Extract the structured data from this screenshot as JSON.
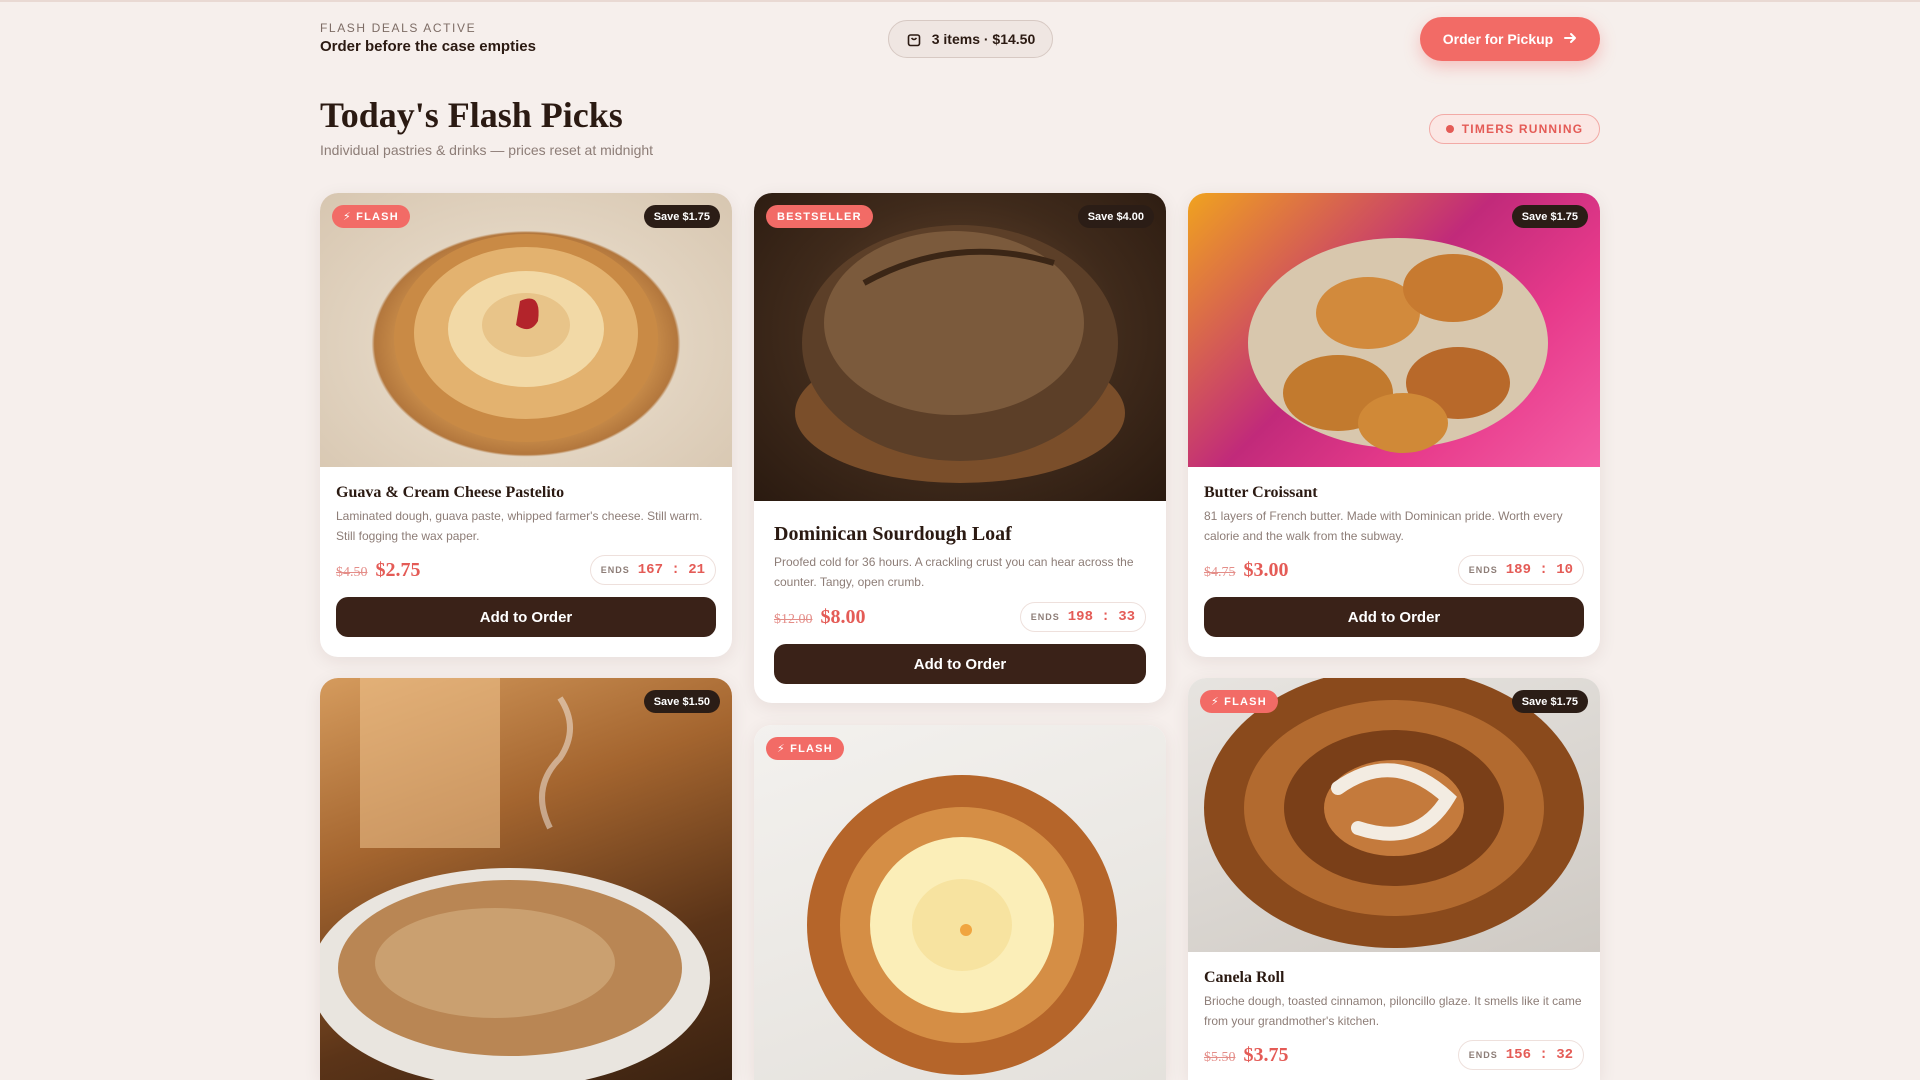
{
  "header": {
    "eyebrow": "FLASH DEALS ACTIVE",
    "subtitle": "Order before the case empties",
    "cart": "3 items · $14.50",
    "order_button": "Order for Pickup",
    "order_icon": "arrow-right-icon"
  },
  "main": {
    "title": "Today's Flash Picks",
    "subtitle": "Individual pastries & drinks — prices reset at midnight",
    "timers": "TIMERS RUNNING"
  },
  "colors": {
    "accent": "#f26b66",
    "dark": "#3a2218",
    "background": "#f6efec"
  },
  "products": [
    {
      "badge": "⚡ FLASH",
      "save": "Save $1.75",
      "title": "Guava & Cream Cheese Pastelito",
      "desc": "Laminated dough, guava paste, whipped farmer's cheese. Still warm. Still fogging the wax paper.",
      "old_price": "$4.50",
      "price": "$2.75",
      "ends_label": "ENDS",
      "ends_time": "167 : 21",
      "button": "Add to Order"
    },
    {
      "badge": "BESTSELLER",
      "save": "Save $4.00",
      "title": "Dominican Sourdough Loaf",
      "desc": "Proofed cold for 36 hours. A crackling crust you can hear across the counter. Tangy, open crumb.",
      "old_price": "$12.00",
      "price": "$8.00",
      "ends_label": "ENDS",
      "ends_time": "198 : 33",
      "button": "Add to Order"
    },
    {
      "badge": "",
      "save": "Save $1.75",
      "title": "Butter Croissant",
      "desc": "81 layers of French butter. Made with Dominican pride. Worth every calorie and the walk from the subway.",
      "old_price": "$4.75",
      "price": "$3.00",
      "ends_label": "ENDS",
      "ends_time": "189 : 10",
      "button": "Add to Order"
    },
    {
      "badge": "",
      "save": "Save $1.50",
      "title": "",
      "desc": "",
      "old_price": "",
      "price": "",
      "ends_label": "",
      "ends_time": "",
      "button": ""
    },
    {
      "badge": "⚡ FLASH",
      "save": "",
      "title": "",
      "desc": "",
      "old_price": "",
      "price": "",
      "ends_label": "",
      "ends_time": "",
      "button": ""
    },
    {
      "badge": "⚡ FLASH",
      "save": "Save $1.75",
      "title": "Canela Roll",
      "desc": "Brioche dough, toasted cinnamon, piloncillo glaze. It smells like it came from your grandmother's kitchen.",
      "old_price": "$5.50",
      "price": "$3.75",
      "ends_label": "ENDS",
      "ends_time": "156 : 32",
      "button": ""
    }
  ]
}
